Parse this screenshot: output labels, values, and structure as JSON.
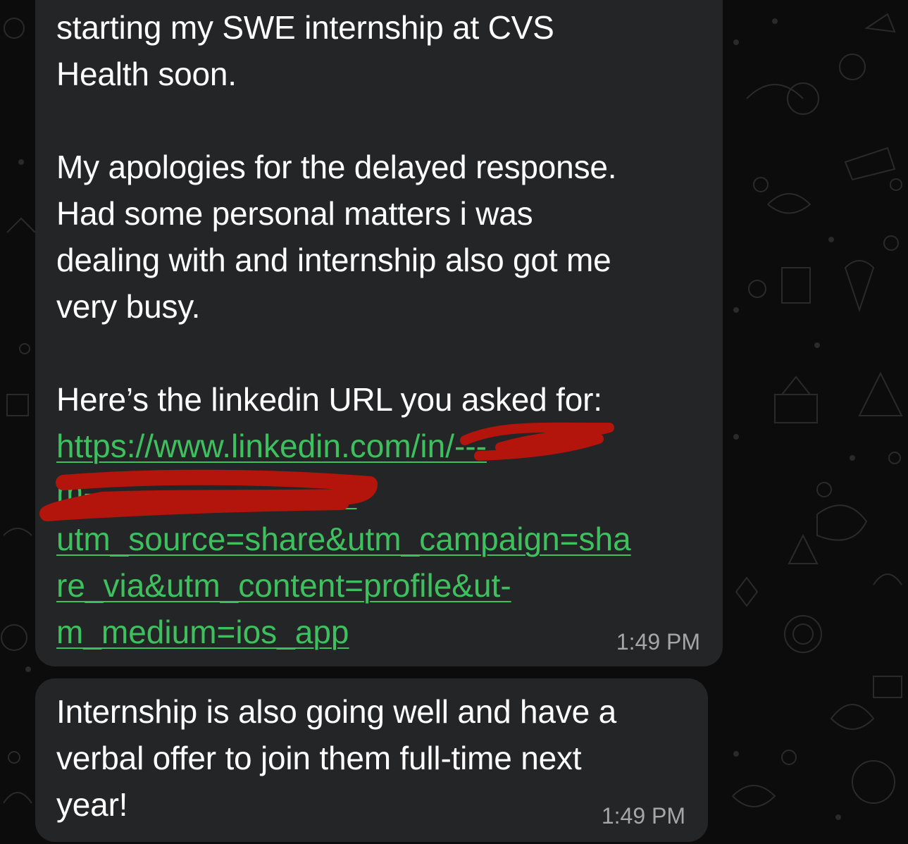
{
  "messages": [
    {
      "lines": [
        "starting my SWE internship at CVS",
        "Health soon.",
        "",
        "My apologies for the delayed response.",
        "Had some personal matters i was",
        "dealing with and internship also got me",
        "very busy.",
        "",
        "Here’s the linkedin URL you asked for:"
      ],
      "link_lines": [
        "https://www.linkedin.com/in/---",
        "m-----------------------l?",
        "utm_source=share&utm_campaign=sha",
        "re_via&utm_content=profile&ut-",
        "m_medium=ios_app"
      ],
      "time": "1:49 PM"
    },
    {
      "lines": [
        "Internship is also going well and have a",
        "verbal offer to join them full-time next",
        "year!"
      ],
      "time": "1:49 PM"
    }
  ],
  "colors": {
    "bubble": "#242526",
    "text": "#ffffff",
    "link": "#3ec05e",
    "timestamp": "#a4a6a8",
    "redaction": "#b3150c"
  }
}
